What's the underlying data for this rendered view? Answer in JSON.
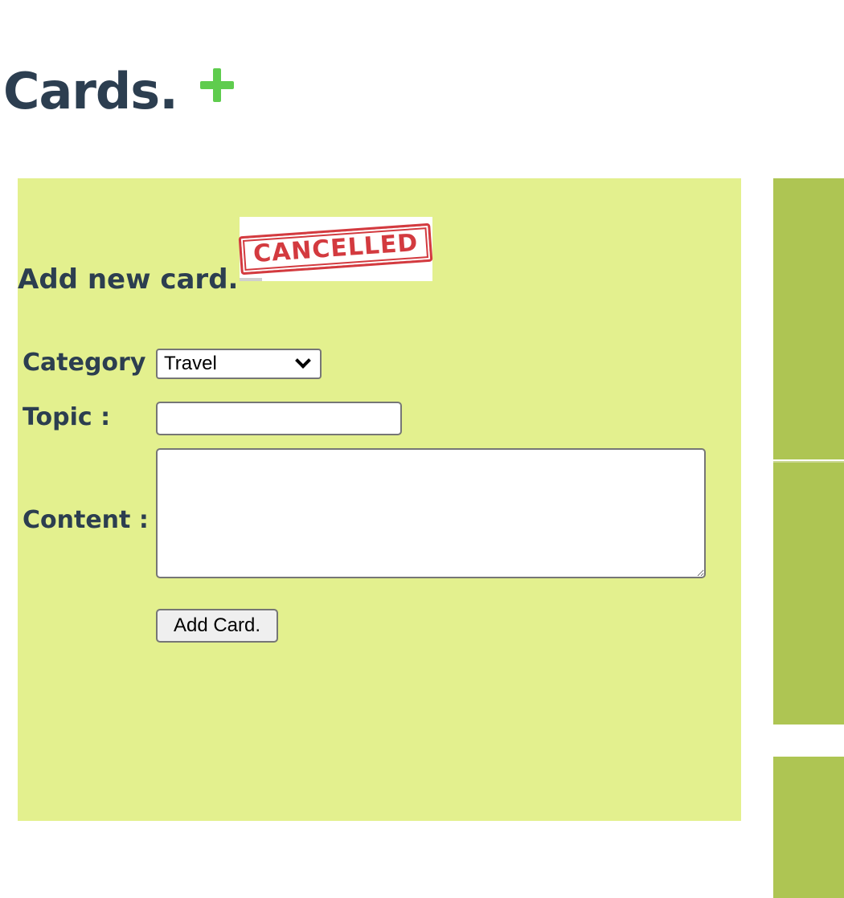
{
  "header": {
    "title": "Cards.",
    "add_icon": "plus-icon",
    "add_icon_color": "#5fcc4e"
  },
  "form": {
    "title": "Add new card.",
    "stamp_text": "CANCELLED",
    "category_label": "Category :",
    "category_value": "Travel",
    "topic_label": "Topic :",
    "topic_value": "",
    "content_label": "Content :",
    "content_value": "",
    "submit_label": "Add Card."
  },
  "colors": {
    "panel_background": "#e3f08e",
    "side_card_background": "#aec553",
    "heading_text": "#2c3e50",
    "stamp_red": "#d33a3f"
  }
}
